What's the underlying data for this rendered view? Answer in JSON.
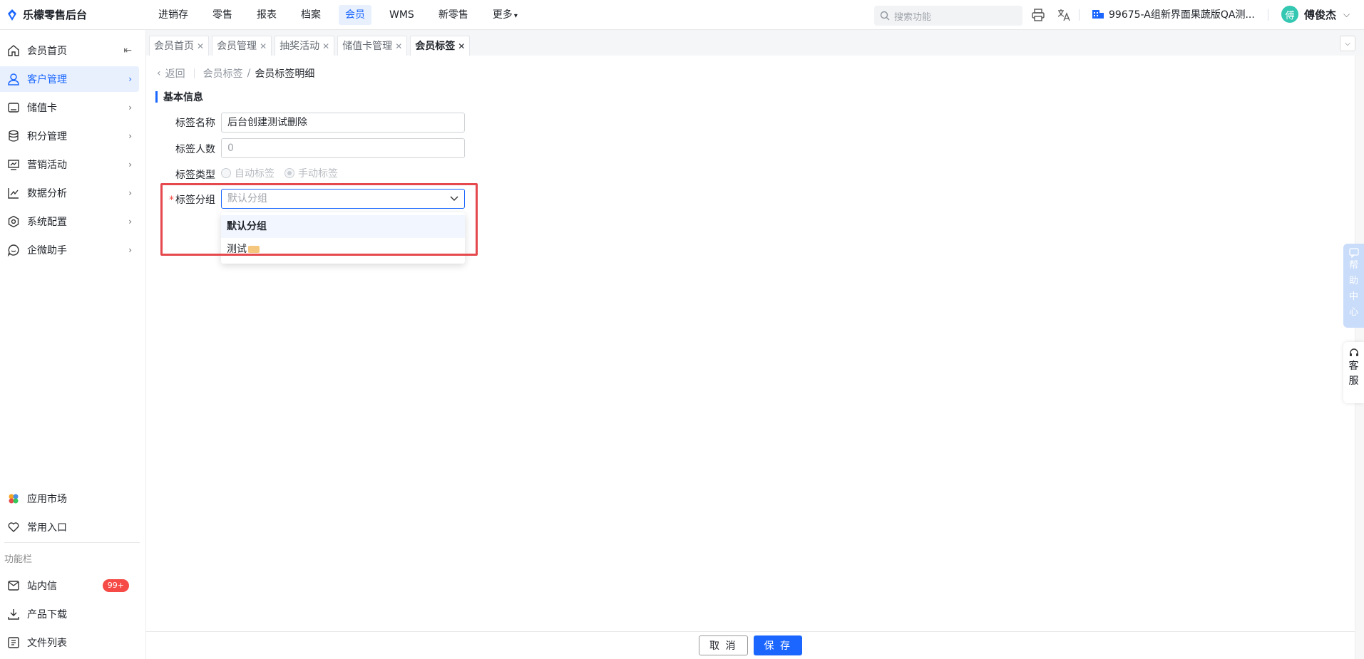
{
  "brand": {
    "title": "乐檬零售后台"
  },
  "topnav": {
    "items": [
      {
        "label": "进销存",
        "active": false
      },
      {
        "label": "零售",
        "active": false
      },
      {
        "label": "报表",
        "active": false
      },
      {
        "label": "档案",
        "active": false
      },
      {
        "label": "会员",
        "active": true
      },
      {
        "label": "WMS",
        "active": false
      },
      {
        "label": "新零售",
        "active": false
      },
      {
        "label": "更多",
        "active": false
      }
    ],
    "search_placeholder": "搜索功能",
    "store_name": "99675-A组新界面果蔬版QA测...",
    "user_name": "傅俊杰",
    "avatar_char": "傅"
  },
  "sidebar": {
    "items": [
      {
        "label": "会员首页",
        "icon": "home-icon"
      },
      {
        "label": "客户管理",
        "icon": "user-icon"
      },
      {
        "label": "储值卡",
        "icon": "card-icon"
      },
      {
        "label": "积分管理",
        "icon": "database-icon"
      },
      {
        "label": "营销活动",
        "icon": "presentation-icon"
      },
      {
        "label": "数据分析",
        "icon": "chart-line-icon"
      },
      {
        "label": "系统配置",
        "icon": "settings-icon"
      },
      {
        "label": "企微助手",
        "icon": "chat-icon"
      }
    ],
    "bottom_items": [
      {
        "label": "应用市场",
        "icon": "app-market-icon"
      },
      {
        "label": "常用入口",
        "icon": "heart-icon"
      }
    ],
    "caption": "功能栏",
    "function_items": [
      {
        "label": "站内信",
        "icon": "mail-icon",
        "badge": "99+"
      },
      {
        "label": "产品下载",
        "icon": "download-icon"
      },
      {
        "label": "文件列表",
        "icon": "file-list-icon"
      }
    ]
  },
  "tabs": [
    {
      "label": "会员首页"
    },
    {
      "label": "会员管理"
    },
    {
      "label": "抽奖活动"
    },
    {
      "label": "储值卡管理"
    },
    {
      "label": "会员标签"
    }
  ],
  "breadcrumb": {
    "back": "返回",
    "parent": "会员标签",
    "current": "会员标签明细"
  },
  "form": {
    "section_title": "基本信息",
    "name_label": "标签名称",
    "name_value": "后台创建测试删除",
    "count_label": "标签人数",
    "count_placeholder": "0",
    "type_label": "标签类型",
    "type_options": [
      "自动标签",
      "手动标签"
    ],
    "type_selected": "手动标签",
    "group_label": "标签分组",
    "group_placeholder": "默认分组",
    "group_options": [
      "默认分组",
      "测试"
    ],
    "group_selected": "默认分组"
  },
  "footer": {
    "cancel": "取 消",
    "save": "保 存"
  },
  "float": {
    "help_chars": [
      "帮",
      "助",
      "中",
      "心"
    ],
    "cs_chars": [
      "客",
      "服"
    ]
  },
  "colors": {
    "accent": "#1a66ff",
    "highlight": "#e5484d",
    "badge": "#f54a45"
  }
}
